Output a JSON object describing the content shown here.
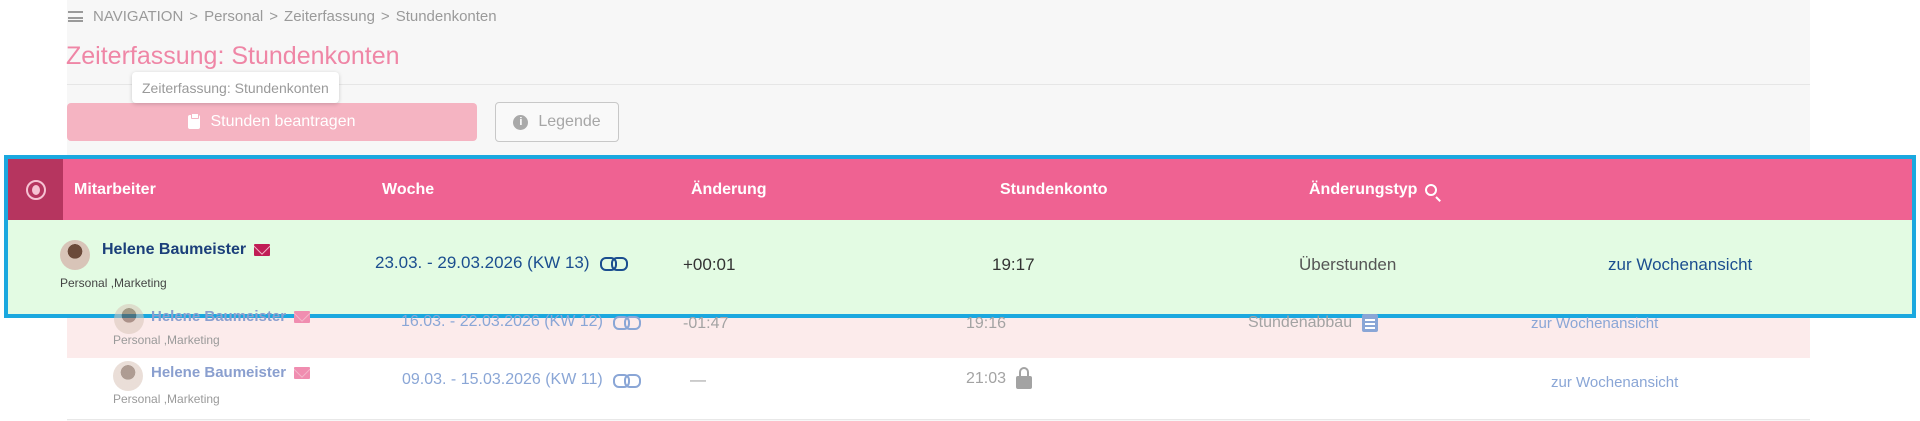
{
  "breadcrumb": {
    "items": [
      "NAVIGATION",
      "Personal",
      "Zeiterfassung",
      "Stundenkonten"
    ],
    "separator": ">"
  },
  "page": {
    "title": "Zeiterfassung: Stundenkonten",
    "tooltip": "Zeiterfassung: Stundenkonten"
  },
  "toolbar": {
    "request_label": "Stunden beantragen",
    "legend_label": "Legende"
  },
  "table": {
    "columns": {
      "employee": "Mitarbeiter",
      "week": "Woche",
      "change": "Änderung",
      "balance": "Stundenkonto",
      "change_type": "Änderungstyp"
    },
    "rows": [
      {
        "name": "Helene Baumeister",
        "dept": "Personal ,Marketing",
        "week": "23.03. - 29.03.2026 (KW 13)",
        "change": "+00:01",
        "balance": "19:17",
        "change_type": "Überstunden",
        "link": "zur Wochenansicht",
        "state": "highlighted"
      },
      {
        "name": "Helene Baumeister",
        "dept": "Personal ,Marketing",
        "week": "16.03. - 22.03.2026 (KW 12)",
        "change": "-01:47",
        "balance": "19:16",
        "change_type": "Stundenabbau",
        "link": "zur Wochenansicht",
        "state": "negative"
      },
      {
        "name": "Helene Baumeister",
        "dept": "Personal ,Marketing",
        "week": "09.03. - 15.03.2026 (KW 11)",
        "change": "—",
        "balance": "21:03",
        "change_type": "",
        "link": "zur Wochenansicht",
        "state": "locked"
      }
    ]
  },
  "colors": {
    "header_pink": "#ef6292",
    "highlight_border": "#1ba8df",
    "row_highlight_bg": "#e3fbe3",
    "row_negative_bg": "#fcebeb",
    "title_pink": "#ef86a6"
  }
}
